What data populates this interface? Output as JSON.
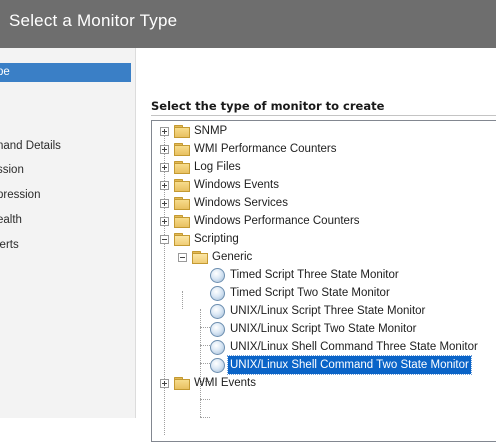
{
  "window": {
    "title": "Select a Monitor Type"
  },
  "sidebar": {
    "items": [
      {
        "label": "pe",
        "active": true
      },
      {
        "label": "nand Details",
        "active": false
      },
      {
        "label": "ssion",
        "active": false
      },
      {
        "label": "pression",
        "active": false
      },
      {
        "label": "ealth",
        "active": false
      },
      {
        "label": "lerts",
        "active": false
      }
    ]
  },
  "main": {
    "heading": "Select the type of monitor to create",
    "tree": {
      "folders": [
        {
          "label": "SNMP"
        },
        {
          "label": "WMI Performance Counters"
        },
        {
          "label": "Log Files"
        },
        {
          "label": "Windows Events"
        },
        {
          "label": "Windows Services"
        },
        {
          "label": "Windows Performance Counters"
        },
        {
          "label": "Scripting"
        },
        {
          "label": "Generic"
        },
        {
          "label": "WMI Events"
        }
      ],
      "monitors": [
        {
          "label": "Timed Script Three State Monitor"
        },
        {
          "label": "Timed Script Two State Monitor"
        },
        {
          "label": "UNIX/Linux Script Three State Monitor"
        },
        {
          "label": "UNIX/Linux Script Two State Monitor"
        },
        {
          "label": "UNIX/Linux Shell Command Three State Monitor"
        },
        {
          "label": "UNIX/Linux Shell Command Two State Monitor",
          "selected": true
        }
      ]
    }
  },
  "colors": {
    "title_bar": "#6e6e6e",
    "selection": "#0a64c8",
    "sidebar_active": "#3a7fc6"
  },
  "icons": {
    "folder": "folder-icon",
    "open_folder": "open-folder-icon",
    "monitor": "monitor-type-icon",
    "expand": "plus-box-icon",
    "collapse": "minus-box-icon"
  }
}
